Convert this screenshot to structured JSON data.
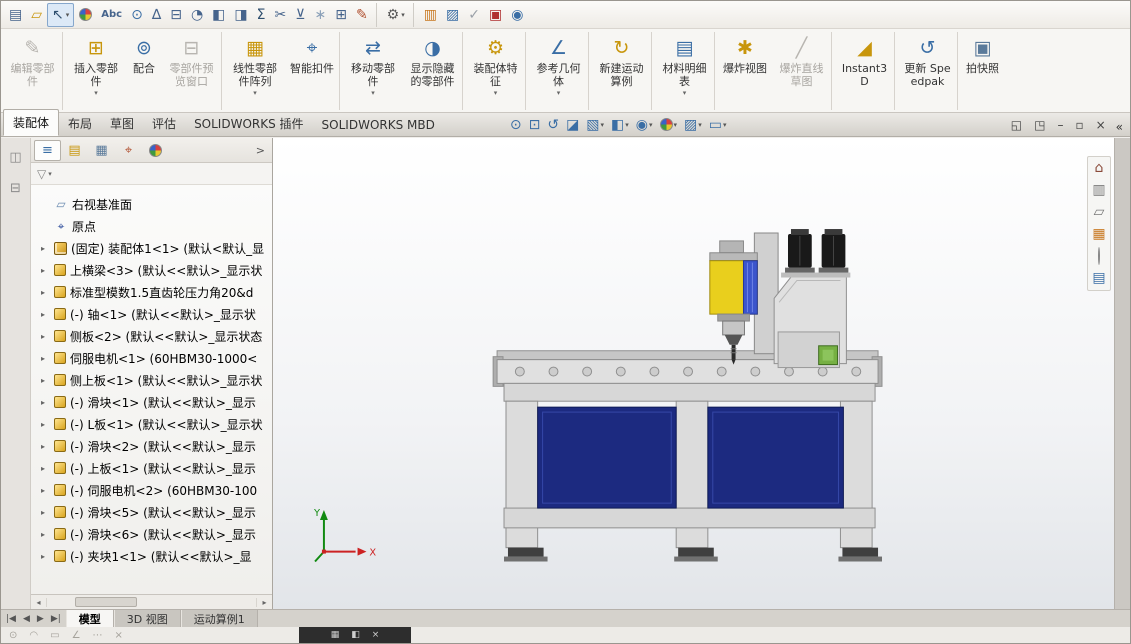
{
  "colors": {
    "accent_blue": "#3a6ea5",
    "panel_navy": "#1c2a80",
    "machine_gray": "#e0e0e0",
    "motor_yellow": "#e9cf1d",
    "motor_blue": "#3b55cc",
    "green_block": "#76b043",
    "triad_x_red": "#cc2222",
    "triad_y_green": "#118a11"
  },
  "menubar": {
    "icons": [
      {
        "name": "new-document-icon",
        "glyph": "▤",
        "color": "#46648c"
      },
      {
        "name": "open-document-icon",
        "glyph": "▱",
        "color": "#c8960c"
      },
      {
        "name": "select-arrow-icon",
        "glyph": "↖",
        "color": "#2f4f6f",
        "boxed": true,
        "caret": true
      },
      {
        "name": "appearance-ball-icon",
        "ball": true
      },
      {
        "name": "spell-check-icon",
        "glyph": "Abc",
        "color": "#46648c",
        "text": true
      },
      {
        "name": "search-icon",
        "glyph": "⊙",
        "color": "#3a6ea5"
      },
      {
        "name": "measure-icon",
        "glyph": "∆",
        "color": "#46648c"
      },
      {
        "name": "section-view-icon",
        "glyph": "⊟",
        "color": "#46648c"
      },
      {
        "name": "performance-icon",
        "glyph": "◔",
        "color": "#46648c"
      },
      {
        "name": "assembly-visualization-icon",
        "glyph": "◧",
        "color": "#46648c"
      },
      {
        "name": "interference-detection-icon",
        "glyph": "◨",
        "color": "#46648c"
      },
      {
        "name": "equations-icon",
        "glyph": "Σ",
        "color": "#2f4f6f"
      },
      {
        "name": "trim-icon",
        "glyph": "✂",
        "color": "#46648c"
      },
      {
        "name": "simulation-icon",
        "glyph": "⊻",
        "color": "#46648c"
      },
      {
        "name": "freeze-bar-icon",
        "glyph": "∗",
        "color": "#8aa0b8"
      },
      {
        "name": "copy-settings-icon",
        "glyph": "⊞",
        "color": "#46648c"
      },
      {
        "name": "format-painter-icon",
        "glyph": "✎",
        "color": "#b05030",
        "sep_after": true
      },
      {
        "name": "options-gear-icon",
        "glyph": "⚙",
        "color": "#5a5a5a",
        "caret": true,
        "sep_after": true
      },
      {
        "name": "toolbox-icon",
        "glyph": "▥",
        "color": "#c87820"
      },
      {
        "name": "property-tab-builder-icon",
        "glyph": "▨",
        "color": "#3a6ea5"
      },
      {
        "name": "task-scheduler-icon",
        "glyph": "✓",
        "color": "#9aa0a8"
      },
      {
        "name": "pdm-icon",
        "glyph": "▣",
        "color": "#b03030"
      },
      {
        "name": "help-icon",
        "glyph": "◉",
        "color": "#3a6ea5"
      }
    ]
  },
  "ribbon": {
    "buttons": [
      {
        "name": "edit-component-button",
        "label": "编辑零部件",
        "glyph": "✎",
        "glyph_color": "#b8b5b0",
        "disabled": true,
        "sep_after": true
      },
      {
        "name": "insert-components-button",
        "label": "插入零部件",
        "glyph": "⊞",
        "glyph_color": "#c8960c",
        "caret": true
      },
      {
        "name": "mate-button",
        "label": "配合",
        "glyph": "⊚",
        "glyph_color": "#3a6ea5"
      },
      {
        "name": "component-preview-button",
        "label": "零部件预览窗口",
        "glyph": "⊟",
        "glyph_color": "#b8b5b0",
        "disabled": true,
        "sep_after": true
      },
      {
        "name": "linear-component-pattern-button",
        "label": "线性零部件阵列",
        "glyph": "▦",
        "glyph_color": "#c8960c",
        "caret": true
      },
      {
        "name": "smart-fasteners-button",
        "label": "智能扣件",
        "glyph": "⌖",
        "glyph_color": "#3a6ea5",
        "sep_after": true
      },
      {
        "name": "move-component-button",
        "label": "移动零部件",
        "glyph": "⇄",
        "glyph_color": "#3a6ea5",
        "caret": true
      },
      {
        "name": "show-hidden-components-button",
        "label": "显示隐藏的零部件",
        "glyph": "◑",
        "glyph_color": "#3a6ea5",
        "sep_after": true
      },
      {
        "name": "assembly-features-button",
        "label": "装配体特征",
        "glyph": "⚙",
        "glyph_color": "#c8960c",
        "caret": true,
        "sep_after": true
      },
      {
        "name": "reference-geometry-button",
        "label": "参考几何体",
        "glyph": "∠",
        "glyph_color": "#3a6ea5",
        "caret": true,
        "sep_after": true
      },
      {
        "name": "new-motion-study-button",
        "label": "新建运动算例",
        "glyph": "↻",
        "glyph_color": "#c8960c",
        "sep_after": true
      },
      {
        "name": "bill-of-materials-button",
        "label": "材料明细表",
        "glyph": "▤",
        "glyph_color": "#3a6ea5",
        "caret": true,
        "sep_after": true
      },
      {
        "name": "exploded-view-button",
        "label": "爆炸视图",
        "glyph": "✱",
        "glyph_color": "#c8960c"
      },
      {
        "name": "explode-line-sketch-button",
        "label": "爆炸直线草图",
        "glyph": "╱",
        "glyph_color": "#b8b5b0",
        "disabled": true,
        "sep_after": true
      },
      {
        "name": "instant3d-button",
        "label": "Instant3D",
        "glyph": "◢",
        "glyph_color": "#c8960c",
        "sep_after": true
      },
      {
        "name": "update-speedpak-button",
        "label": "更新 Speedpak",
        "glyph": "↺",
        "glyph_color": "#3a6ea5",
        "sep_after": true
      },
      {
        "name": "take-snapshot-button",
        "label": "拍快照",
        "glyph": "▣",
        "glyph_color": "#5a7a9a"
      }
    ]
  },
  "tabrow": {
    "tabs": [
      {
        "label": "装配体",
        "active": true
      },
      {
        "label": "布局"
      },
      {
        "label": "草图"
      },
      {
        "label": "评估"
      },
      {
        "label": "SOLIDWORKS 插件"
      },
      {
        "label": "SOLIDWORKS MBD"
      }
    ],
    "view_icons": [
      {
        "name": "zoom-fit-icon",
        "glyph": "⊙"
      },
      {
        "name": "zoom-area-icon",
        "glyph": "⊡"
      },
      {
        "name": "previous-view-icon",
        "glyph": "↺"
      },
      {
        "name": "section-view-icon",
        "glyph": "◪"
      },
      {
        "name": "view-orientation-icon",
        "glyph": "▧",
        "caret": true
      },
      {
        "name": "display-style-icon",
        "glyph": "◧",
        "caret": true
      },
      {
        "name": "hide-show-items-icon",
        "glyph": "◉",
        "caret": true
      },
      {
        "name": "edit-appearance-icon",
        "ball": true,
        "caret": true
      },
      {
        "name": "apply-scene-icon",
        "glyph": "▨",
        "caret": true
      },
      {
        "name": "view-settings-icon",
        "glyph": "▭",
        "caret": true
      }
    ],
    "window_icons": [
      {
        "name": "float-window-icon",
        "glyph": "◱"
      },
      {
        "name": "tile-window-icon",
        "glyph": "◳"
      },
      {
        "name": "minimize-button",
        "glyph": "–"
      },
      {
        "name": "restore-button",
        "glyph": "▫"
      },
      {
        "name": "close-button",
        "glyph": "×"
      }
    ],
    "collapse_chevron": "«"
  },
  "left_strip": {
    "icons": [
      {
        "name": "dock-toolbar-icon-top",
        "glyph": "◫"
      },
      {
        "name": "dock-toolbar-icon-bottom",
        "glyph": "⊟"
      }
    ]
  },
  "tree": {
    "header_tabs": [
      {
        "name": "featuremanager-tab",
        "glyph": "≡",
        "color": "#3a6ea5",
        "active": true
      },
      {
        "name": "propertymanager-tab",
        "glyph": "▤",
        "color": "#c8960c"
      },
      {
        "name": "configurationmanager-tab",
        "glyph": "▦",
        "color": "#5a7a9a"
      },
      {
        "name": "dimxpertmanager-tab",
        "glyph": "⌖",
        "color": "#b05030"
      },
      {
        "name": "displaymanager-tab",
        "ball": true
      }
    ],
    "expand_chevron": ">",
    "filter_glyph": "▽",
    "filter_caret": "▾",
    "row_arrow": "▸",
    "scroll_left": "◂",
    "scroll_right": "▸",
    "items": [
      {
        "text": "右视基准面",
        "kind": "plane",
        "glyph": "▱",
        "icon_color": "#6a8ab0"
      },
      {
        "text": "原点",
        "kind": "origin",
        "glyph": "⌖",
        "icon_color": "#2a4a9a"
      },
      {
        "text": "(固定) 装配体1<1> (默认<默认_显",
        "kind": "assembly",
        "arrow": true
      },
      {
        "text": "上横梁<3> (默认<<默认>_显示状",
        "kind": "part",
        "arrow": true
      },
      {
        "text": "标准型模数1.5直齿轮压力角20&d",
        "kind": "part",
        "arrow": true
      },
      {
        "text": "(-) 轴<1> (默认<<默认>_显示状",
        "kind": "part",
        "arrow": true
      },
      {
        "text": "侧板<2> (默认<<默认>_显示状态",
        "kind": "part",
        "arrow": true
      },
      {
        "text": "伺服电机<1> (60HBM30-1000<",
        "kind": "part",
        "arrow": true
      },
      {
        "text": "侧上板<1> (默认<<默认>_显示状",
        "kind": "part",
        "arrow": true
      },
      {
        "text": "(-) 滑块<1> (默认<<默认>_显示",
        "kind": "part",
        "arrow": true
      },
      {
        "text": "(-) L板<1> (默认<<默认>_显示状",
        "kind": "part",
        "arrow": true
      },
      {
        "text": "(-) 滑块<2> (默认<<默认>_显示",
        "kind": "part",
        "arrow": true
      },
      {
        "text": "(-) 上板<1> (默认<<默认>_显示",
        "kind": "part",
        "arrow": true
      },
      {
        "text": "(-) 伺服电机<2> (60HBM30-100",
        "kind": "part",
        "arrow": true
      },
      {
        "text": "(-) 滑块<5> (默认<<默认>_显示",
        "kind": "part",
        "arrow": true
      },
      {
        "text": "(-) 滑块<6> (默认<<默认>_显示",
        "kind": "part",
        "arrow": true
      },
      {
        "text": "(-) 夹块1<1> (默认<<默认>_显",
        "kind": "part",
        "arrow": true
      }
    ]
  },
  "viewport": {
    "triad": {
      "x_label": "X",
      "y_label": "Y"
    }
  },
  "right_toolbar": {
    "icons": [
      {
        "name": "home-icon",
        "glyph": "⌂",
        "color": "#8a4a3a"
      },
      {
        "name": "solid-bodies-icon",
        "glyph": "▥",
        "color": "#777777"
      },
      {
        "name": "sheet-icon",
        "glyph": "▱",
        "color": "#777777"
      },
      {
        "name": "grid-icon",
        "glyph": "▦",
        "color": "#c87820"
      },
      {
        "name": "appearance-target-icon",
        "ball": true
      },
      {
        "name": "list-icon",
        "glyph": "▤",
        "color": "#3a6ea5"
      }
    ]
  },
  "bottom_tabs": {
    "nav": [
      {
        "name": "first-tab-button",
        "glyph": "|◀"
      },
      {
        "name": "prev-tab-button",
        "glyph": "◀"
      },
      {
        "name": "next-tab-button",
        "glyph": "▶"
      },
      {
        "name": "last-tab-button",
        "glyph": "▶|"
      }
    ],
    "tabs": [
      {
        "label": "模型",
        "active": true
      },
      {
        "label": "3D 视图"
      },
      {
        "label": "运动算例1"
      }
    ]
  },
  "status": {
    "icons": [
      {
        "name": "status-icon-circle",
        "glyph": "⊙"
      },
      {
        "name": "status-icon-arc",
        "glyph": "◠"
      },
      {
        "name": "status-icon-rect",
        "glyph": "▭"
      },
      {
        "name": "status-icon-angle",
        "glyph": "∠"
      },
      {
        "name": "status-icon-more",
        "glyph": "⋯"
      },
      {
        "name": "status-icon-close",
        "glyph": "×"
      }
    ],
    "dark_panel_icons": [
      {
        "name": "mini-grid-icon",
        "glyph": "▦"
      },
      {
        "name": "mini-pane-icon",
        "glyph": "◧"
      },
      {
        "name": "mini-close-icon",
        "glyph": "×"
      }
    ]
  }
}
